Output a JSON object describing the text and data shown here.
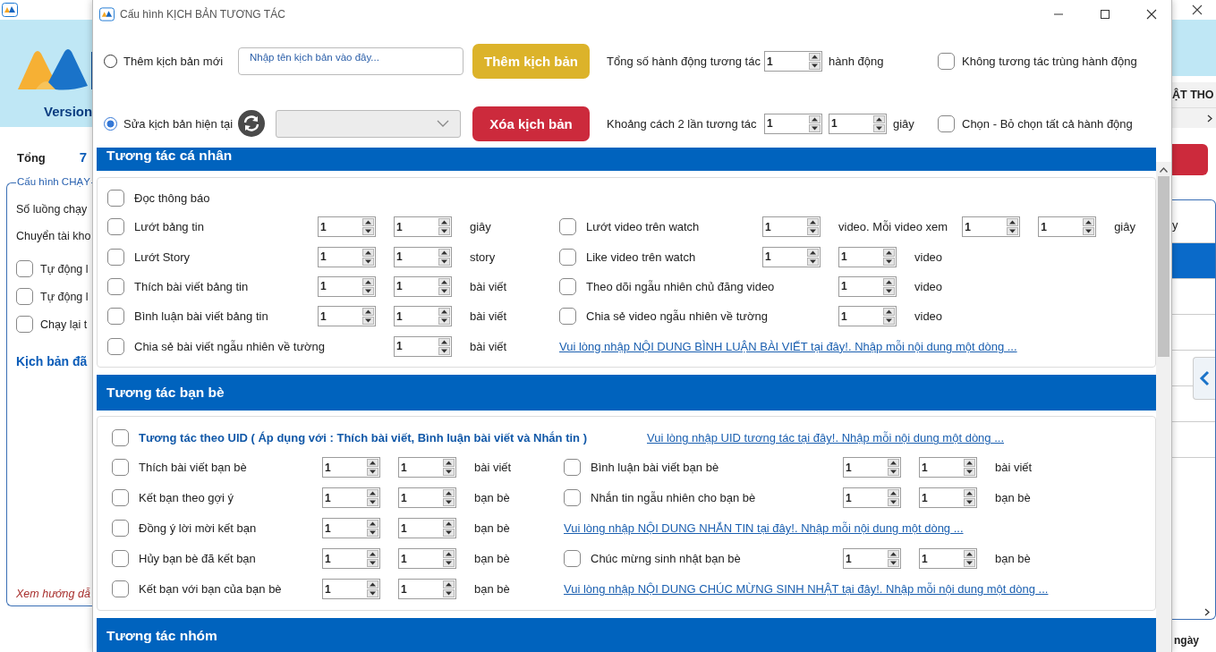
{
  "app": {
    "left": {
      "version": "Version",
      "total_label": "Tổng",
      "total_value": "7",
      "group_title": "Cấu hình CHẠY",
      "fields": [
        "Số luồng chạy",
        "Chuyển tài kho"
      ],
      "options": [
        {
          "label": "Tự động l",
          "checked": false
        },
        {
          "label": "Tự động l",
          "checked": false
        },
        {
          "label": "Chạy lại t",
          "checked": false
        }
      ],
      "scripts_label": "Kịch bản đã",
      "guide_link": "Xem hướng dẫ"
    },
    "right": {
      "heading": "ẬT THO",
      "list_rows": [
        {
          "text": "y",
          "selected": false
        },
        {
          "selected": true
        }
      ],
      "footer": "ngày"
    }
  },
  "dialog": {
    "title": "Cấu hình KỊCH BẢN TƯƠNG TÁC",
    "modes": [
      {
        "label": "Thêm kịch bản mới",
        "selected": false
      },
      {
        "label": "Sửa kịch bản hiện tại",
        "selected": true
      }
    ],
    "name_field": {
      "placeholder": "Nhập tên kịch bản vào đây..."
    },
    "add_button": "Thêm kịch bản",
    "delete_button": "Xóa kịch bản",
    "total_actions": {
      "label": "Tổng số hành động tương tác",
      "values": [
        "1"
      ],
      "unit": "hành động"
    },
    "interval": {
      "label": "Khoảng cách 2 lần tương tác",
      "values": [
        "1",
        "1"
      ],
      "unit": "giây"
    },
    "options": [
      {
        "label": "Không tương tác trùng hành động",
        "checked": false
      },
      {
        "label": "Chọn - Bỏ chọn tất cả hành động",
        "checked": false
      }
    ],
    "sections": [
      {
        "title": "Tương tác cá nhân",
        "top": [
          {
            "kind": "plain",
            "label": "Đọc thông báo",
            "checked": false
          }
        ],
        "left": [
          {
            "kind": "pair",
            "label": "Lướt bảng tin",
            "checked": false,
            "parts": [
              {
                "spin": "1"
              },
              {
                "spin": "1"
              },
              {
                "text": "giây"
              }
            ]
          },
          {
            "kind": "pair",
            "label": "Lướt Story",
            "checked": false,
            "parts": [
              {
                "spin": "1"
              },
              {
                "spin": "1"
              },
              {
                "text": "story"
              }
            ]
          },
          {
            "kind": "pair",
            "label": "Thích bài viết bảng tin",
            "checked": false,
            "parts": [
              {
                "spin": "1"
              },
              {
                "spin": "1"
              },
              {
                "text": "bài viết"
              }
            ]
          },
          {
            "kind": "pair",
            "label": "Bình luận bài viết bảng tin",
            "checked": false,
            "parts": [
              {
                "spin": "1"
              },
              {
                "spin": "1"
              },
              {
                "text": "bài viết"
              }
            ]
          },
          {
            "kind": "single",
            "label": "Chia sẻ bài viết ngẫu nhiên về tường",
            "checked": false,
            "parts": [
              {
                "spin": "1"
              },
              {
                "text": "bài viết"
              }
            ]
          }
        ],
        "right": [
          {
            "kind": "pair",
            "label": "Lướt video trên watch",
            "checked": false,
            "parts": [
              {
                "spin": "1"
              },
              {
                "text": "video. Mỗi video xem"
              },
              {
                "spin": "1"
              },
              {
                "spin": "1"
              },
              {
                "text": "giây"
              }
            ]
          },
          {
            "kind": "pair",
            "label": "Like video trên watch",
            "checked": false,
            "parts": [
              {
                "spin": "1"
              },
              {
                "spin": "1"
              },
              {
                "text": "video"
              }
            ]
          },
          {
            "kind": "single",
            "label": "Theo dõi ngẫu nhiên chủ đăng video",
            "checked": false,
            "parts": [
              {
                "spin": "1"
              },
              {
                "text": "video"
              }
            ]
          },
          {
            "kind": "single",
            "label": "Chia sẻ video ngẫu nhiên về tường",
            "checked": false,
            "parts": [
              {
                "spin": "1"
              },
              {
                "text": "video"
              }
            ]
          },
          {
            "kind": "link",
            "label": "Vui lòng nhập NỘI DUNG BÌNH LUẬN BÀI VIẾT tại đây!. Nhập mỗi nội dung một dòng ..."
          }
        ]
      },
      {
        "title": "Tương tác bạn bè",
        "top": [
          {
            "kind": "uid",
            "label": "Tương tác theo UID ( Áp dụng với : Thích bài viết, Bình luận bài viết và Nhắn tin )",
            "checked": false,
            "link": "Vui lòng nhập UID tương tác tại đây!. Nhập mỗi nội dung một dòng ..."
          }
        ],
        "left": [
          {
            "kind": "pair",
            "label": "Thích bài viết bạn bè",
            "checked": false,
            "parts": [
              {
                "spin": "1"
              },
              {
                "spin": "1"
              },
              {
                "text": "bài viết"
              }
            ]
          },
          {
            "kind": "pair",
            "label": "Kết bạn theo gợi ý",
            "checked": false,
            "parts": [
              {
                "spin": "1"
              },
              {
                "spin": "1"
              },
              {
                "text": "bạn bè"
              }
            ]
          },
          {
            "kind": "pair",
            "label": "Đồng ý lời mời kết bạn",
            "checked": false,
            "parts": [
              {
                "spin": "1"
              },
              {
                "spin": "1"
              },
              {
                "text": "bạn bè"
              }
            ]
          },
          {
            "kind": "pair",
            "label": "Hủy bạn bè đã kết bạn",
            "checked": false,
            "parts": [
              {
                "spin": "1"
              },
              {
                "spin": "1"
              },
              {
                "text": "bạn bè"
              }
            ]
          },
          {
            "kind": "pair",
            "label": "Kết bạn với bạn của bạn bè",
            "checked": false,
            "parts": [
              {
                "spin": "1"
              },
              {
                "spin": "1"
              },
              {
                "text": "bạn bè"
              }
            ]
          }
        ],
        "right": [
          {
            "kind": "pair",
            "label": "Bình luận bài viết bạn bè",
            "checked": false,
            "parts": [
              {
                "spin": "1"
              },
              {
                "spin": "1"
              },
              {
                "text": "bài viết"
              }
            ]
          },
          {
            "kind": "pair",
            "label": "Nhắn tin ngẫu nhiên cho bạn bè",
            "checked": false,
            "parts": [
              {
                "spin": "1"
              },
              {
                "spin": "1"
              },
              {
                "text": "bạn bè"
              }
            ]
          },
          {
            "kind": "link",
            "label": "Vui lòng nhập NỘI DUNG NHẮN TIN tại đây!. Nhập mỗi nội dung một dòng ..."
          },
          {
            "kind": "pair",
            "label": "Chúc mừng sinh nhật bạn bè",
            "checked": false,
            "parts": [
              {
                "spin": "1"
              },
              {
                "spin": "1"
              },
              {
                "text": "bạn bè"
              }
            ]
          },
          {
            "kind": "link",
            "label": "Vui lòng nhập NỘI DUNG CHÚC MỪNG SINH NHẬT tại đây!. Nhập mỗi nội dung một dòng ..."
          }
        ]
      },
      {
        "title": "Tương tác nhóm"
      }
    ]
  }
}
